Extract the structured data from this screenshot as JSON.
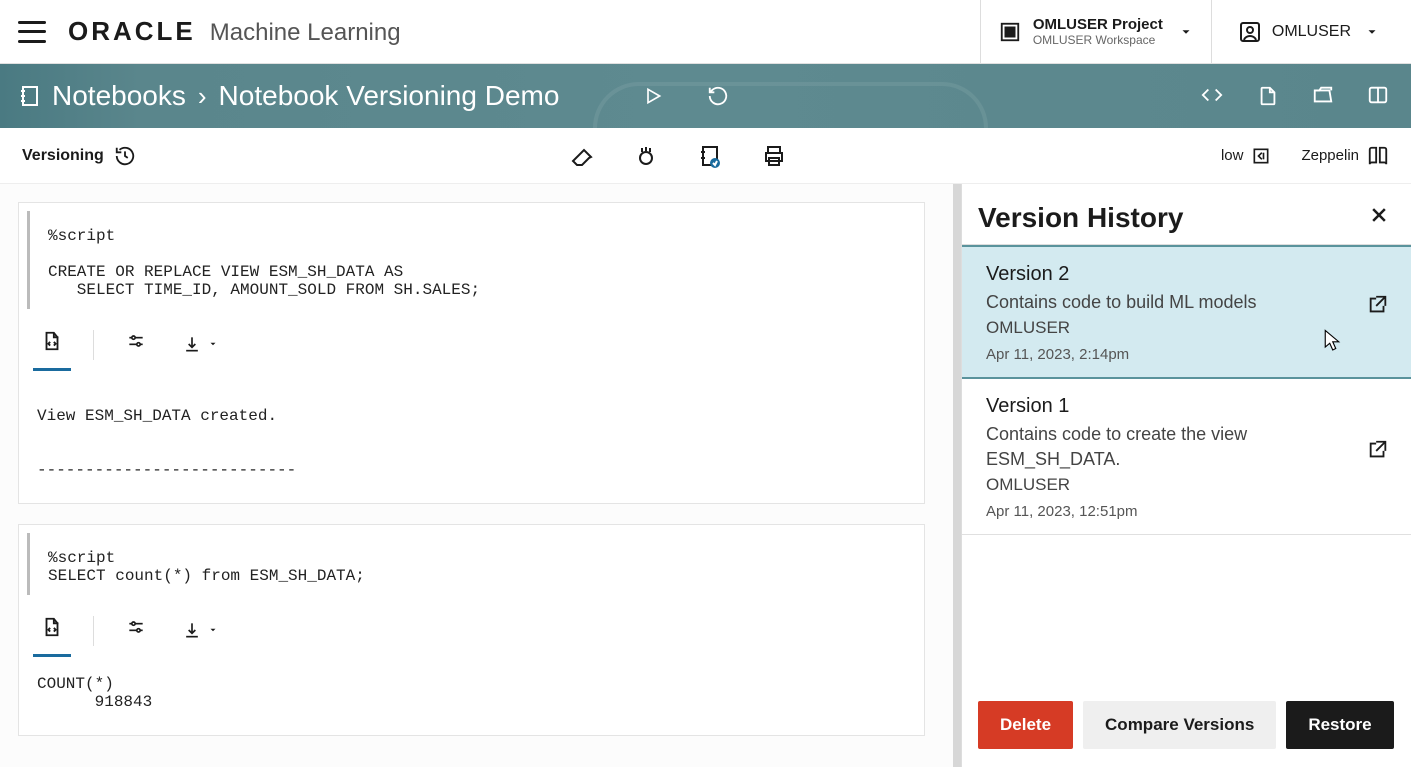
{
  "header": {
    "brand_main": "ORACLE",
    "brand_sub": "Machine Learning",
    "project_name": "OMLUSER Project",
    "project_workspace": "OMLUSER Workspace",
    "user_name": "OMLUSER"
  },
  "banner": {
    "breadcrumb_root": "Notebooks",
    "breadcrumb_sep": "›",
    "breadcrumb_current": "Notebook Versioning Demo"
  },
  "toolbar": {
    "versioning_label": "Versioning",
    "priority_label": "low",
    "mode_label": "Zeppelin"
  },
  "cells": [
    {
      "code": "%script\n\nCREATE OR REPLACE VIEW ESM_SH_DATA AS\n   SELECT TIME_ID, AMOUNT_SOLD FROM SH.SALES;",
      "output": "\nView ESM_SH_DATA created.\n\n\n---------------------------"
    },
    {
      "code": "%script\nSELECT count(*) from ESM_SH_DATA;",
      "output": "COUNT(*)\n      918843"
    }
  ],
  "history": {
    "title": "Version History",
    "versions": [
      {
        "name": "Version 2",
        "desc": "Contains code to build ML models",
        "user": "OMLUSER",
        "time": "Apr 11, 2023, 2:14pm"
      },
      {
        "name": "Version 1",
        "desc": "Contains code to create the view ESM_SH_DATA.",
        "user": "OMLUSER",
        "time": "Apr 11, 2023, 12:51pm"
      }
    ],
    "delete_label": "Delete",
    "compare_label": "Compare Versions",
    "restore_label": "Restore"
  }
}
